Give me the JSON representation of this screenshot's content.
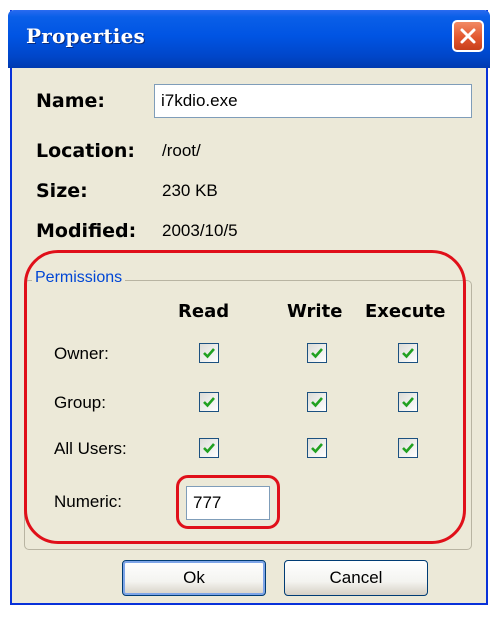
{
  "window": {
    "title": "Properties"
  },
  "fields": {
    "name_label": "Name:",
    "name_value": "i7kdio.exe",
    "location_label": "Location:",
    "location_value": "/root/",
    "size_label": "Size:",
    "size_value": "230 KB",
    "modified_label": "Modified:",
    "modified_value": "2003/10/5"
  },
  "permissions": {
    "group_label": "Permissions",
    "columns": [
      "Read",
      "Write",
      "Execute"
    ],
    "rows": [
      {
        "label": "Owner:",
        "read": true,
        "write": true,
        "execute": true
      },
      {
        "label": "Group:",
        "read": true,
        "write": true,
        "execute": true
      },
      {
        "label": "All Users:",
        "read": true,
        "write": true,
        "execute": true
      }
    ],
    "numeric_label": "Numeric:",
    "numeric_value": "777"
  },
  "buttons": {
    "ok": "Ok",
    "cancel": "Cancel"
  },
  "colors": {
    "highlight": "#e0101a",
    "title_bar": "#0054e3",
    "close": "#e2572f",
    "check": "#21a121"
  }
}
